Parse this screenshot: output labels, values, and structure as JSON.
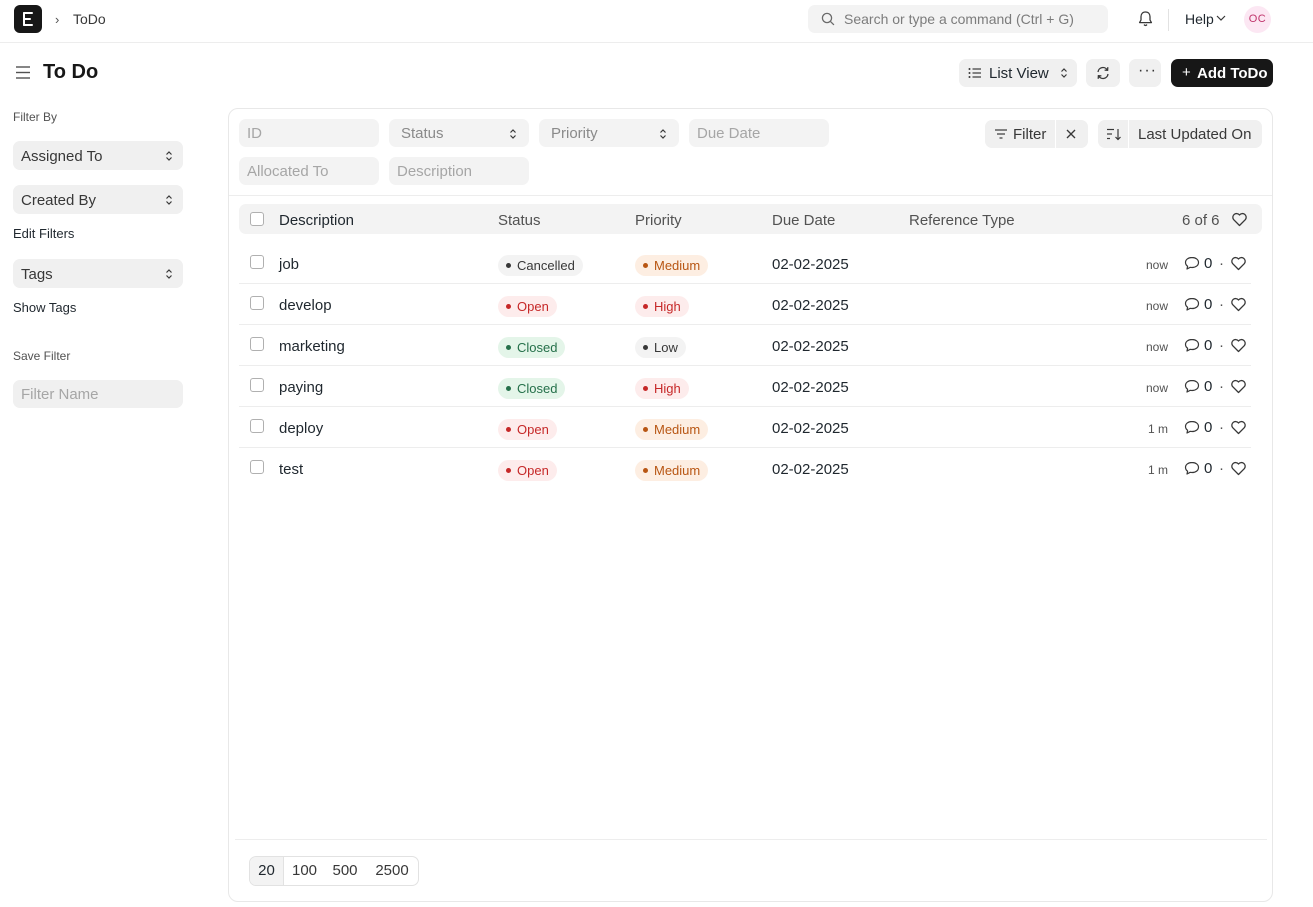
{
  "navbar": {
    "breadcrumb": "ToDo",
    "search_placeholder": "Search or type a command (Ctrl + G)",
    "help_label": "Help",
    "avatar_initials": "OC"
  },
  "header": {
    "title": "To Do",
    "view_label": "List View",
    "more_label": "···",
    "add_label": "Add ToDo"
  },
  "sidebar": {
    "filter_by_label": "Filter By",
    "assigned_to_label": "Assigned To",
    "created_by_label": "Created By",
    "edit_filters_label": "Edit Filters",
    "tags_label": "Tags",
    "show_tags_label": "Show Tags",
    "save_filter_label": "Save Filter",
    "filter_name_placeholder": "Filter Name"
  },
  "filters": {
    "id_placeholder": "ID",
    "status_label": "Status",
    "priority_label": "Priority",
    "due_date_placeholder": "Due Date",
    "allocated_to_placeholder": "Allocated To",
    "description_placeholder": "Description",
    "filter_button_label": "Filter",
    "sort_label": "Last Updated On"
  },
  "table": {
    "columns": {
      "description": "Description",
      "status": "Status",
      "priority": "Priority",
      "due_date": "Due Date",
      "reference_type": "Reference Type"
    },
    "count_label": "6 of 6",
    "rows": [
      {
        "description": "job",
        "status": "Cancelled",
        "priority": "Medium",
        "due_date": "02-02-2025",
        "modified": "now",
        "comments": "0"
      },
      {
        "description": "develop",
        "status": "Open",
        "priority": "High",
        "due_date": "02-02-2025",
        "modified": "now",
        "comments": "0"
      },
      {
        "description": "marketing",
        "status": "Closed",
        "priority": "Low",
        "due_date": "02-02-2025",
        "modified": "now",
        "comments": "0"
      },
      {
        "description": "paying",
        "status": "Closed",
        "priority": "High",
        "due_date": "02-02-2025",
        "modified": "now",
        "comments": "0"
      },
      {
        "description": "deploy",
        "status": "Open",
        "priority": "Medium",
        "due_date": "02-02-2025",
        "modified": "1 m",
        "comments": "0"
      },
      {
        "description": "test",
        "status": "Open",
        "priority": "Medium",
        "due_date": "02-02-2025",
        "modified": "1 m",
        "comments": "0"
      }
    ]
  },
  "pager": {
    "sizes": [
      "20",
      "100",
      "500",
      "2500"
    ],
    "active": "20"
  },
  "colors": {
    "brand_dark": "#171717",
    "pill_gray_bg": "#f3f3f3",
    "pill_gray_fg": "#383838",
    "pill_red_bg": "#fdecec",
    "pill_red_fg": "#c62828",
    "pill_green_bg": "#e4f5e9",
    "pill_green_fg": "#25704a",
    "pill_orange_bg": "#fdeee2",
    "pill_orange_fg": "#b85613"
  }
}
